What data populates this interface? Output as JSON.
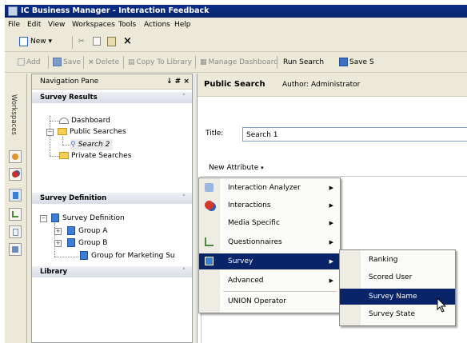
{
  "window": {
    "title": "IC Business Manager - Interaction Feedback"
  },
  "menubar": [
    "File",
    "Edit",
    "View",
    "Workspaces",
    "Tools",
    "Actions",
    "Help"
  ],
  "toolbar1": {
    "new_label": "New"
  },
  "toolbar2": {
    "add": "Add",
    "save": "Save",
    "delete": "Delete",
    "copy_to_library": "Copy To Library",
    "manage_dashboard": "Manage Dashboard",
    "run_search": "Run Search",
    "save_search": "Save S"
  },
  "sidestrip": {
    "label": "Workspaces"
  },
  "nav": {
    "title": "Navigation Pane",
    "pin": "↓ # ×",
    "sections": {
      "survey_results": "Survey Results",
      "survey_definition": "Survey Definition",
      "library": "Library"
    },
    "results": {
      "dashboard": "Dashboard",
      "public_searches": "Public Searches",
      "search2": "Search 2",
      "private_searches": "Private Searches"
    },
    "definition": {
      "root": "Survey Definition",
      "group_a": "Group A",
      "group_b": "Group B",
      "group_marketing": "Group for Marketing Su"
    }
  },
  "main": {
    "header": "Public Search",
    "author": "Author: Administrator",
    "title_label": "Title:",
    "title_value": "Search 1",
    "new_attribute": "New Attribute"
  },
  "context_menu": {
    "items": [
      "Interaction Analyzer",
      "Interactions",
      "Media Specific",
      "Questionnaires",
      "Survey",
      "Advanced",
      "UNION Operator"
    ],
    "selected": "Survey"
  },
  "submenu": {
    "items": [
      "Ranking",
      "Scored User",
      "Survey Name",
      "Survey State"
    ],
    "selected": "Survey Name"
  },
  "colors": {
    "selection": "#0a246a",
    "titlebar": "#0a246a",
    "chrome": "#ece9d8"
  }
}
